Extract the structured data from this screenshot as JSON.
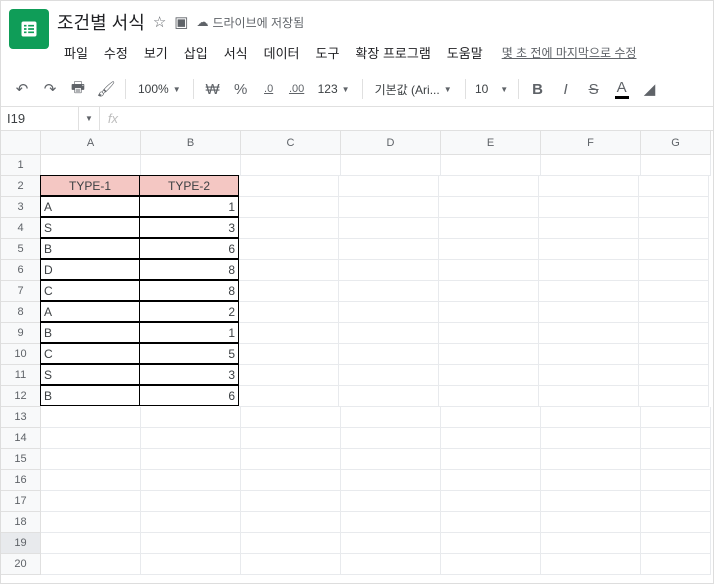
{
  "doc": {
    "title": "조건별 서식",
    "save_status": "드라이브에 저장됨"
  },
  "menus": [
    "파일",
    "수정",
    "보기",
    "삽입",
    "서식",
    "데이터",
    "도구",
    "확장 프로그램",
    "도움말"
  ],
  "last_edit": "몇 초 전에 마지막으로 수정",
  "toolbar": {
    "zoom": "100%",
    "currency": "₩",
    "percent": "%",
    "dec_dec": ".0",
    "inc_dec": ".00",
    "more_formats": "123",
    "font": "기본값 (Ari...",
    "font_size": "10",
    "bold": "B",
    "italic": "I",
    "strike": "S",
    "text_color": "A"
  },
  "namebox": {
    "value": "I19",
    "fx": "fx"
  },
  "columns": [
    "A",
    "B",
    "C",
    "D",
    "E",
    "F",
    "G"
  ],
  "rows_count": 20,
  "selected_row": 19,
  "table": {
    "headers": [
      "TYPE-1",
      "TYPE-2"
    ],
    "rows": [
      [
        "A",
        "1"
      ],
      [
        "S",
        "3"
      ],
      [
        "B",
        "6"
      ],
      [
        "D",
        "8"
      ],
      [
        "C",
        "8"
      ],
      [
        "A",
        "2"
      ],
      [
        "B",
        "1"
      ],
      [
        "C",
        "5"
      ],
      [
        "S",
        "3"
      ],
      [
        "B",
        "6"
      ]
    ]
  }
}
